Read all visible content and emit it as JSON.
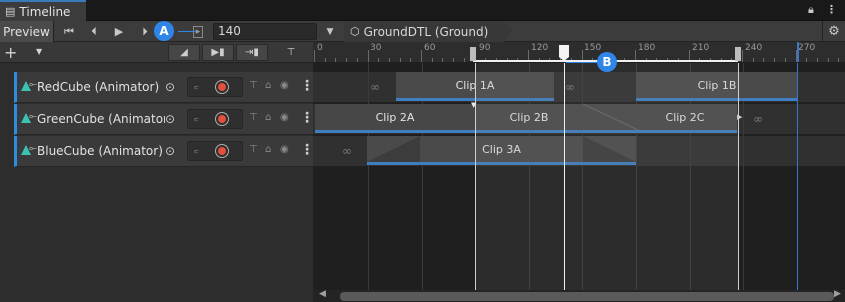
{
  "window": {
    "tab_title": "Timeline",
    "lock_icon": "lock-icon",
    "menu_icon": "more-icon"
  },
  "toolbar": {
    "preview_label": "Preview",
    "frame_value": "140",
    "breadcrumb_label": "GroundDTL (Ground)",
    "buttons": [
      "go-to-start-icon",
      "previous-frame-icon",
      "play-icon",
      "next-frame-icon",
      "go-to-end-icon",
      "play-range-icon"
    ]
  },
  "header": {
    "add_label": "+",
    "buttons": [
      "snap-icon",
      "ripple-icon",
      "clip-edit-icon",
      "pin-icon"
    ]
  },
  "ruler": {
    "labels": [
      "0",
      "30",
      "60",
      "90",
      "120",
      "150",
      "180",
      "210",
      "240",
      "270"
    ]
  },
  "tracks": [
    {
      "name": "RedCube (Animator)",
      "clips": [
        {
          "label": "Clip 1A"
        },
        {
          "label": "Clip 1B"
        }
      ]
    },
    {
      "name": "GreenCube (Animator)",
      "clips": [
        {
          "label": "Clip 2A"
        },
        {
          "label": "Clip 2B"
        },
        {
          "label": "Clip 2C"
        }
      ]
    },
    {
      "name": "BlueCube (Animator)",
      "clips": [
        {
          "label": "Clip 3A"
        }
      ]
    }
  ],
  "callouts": {
    "a": "A",
    "b": "B"
  },
  "colors": {
    "accent": "#2f86e8",
    "track_bar": "#2e8be0",
    "record": "#e0503c",
    "clip_underline": "#3f7ec0"
  }
}
